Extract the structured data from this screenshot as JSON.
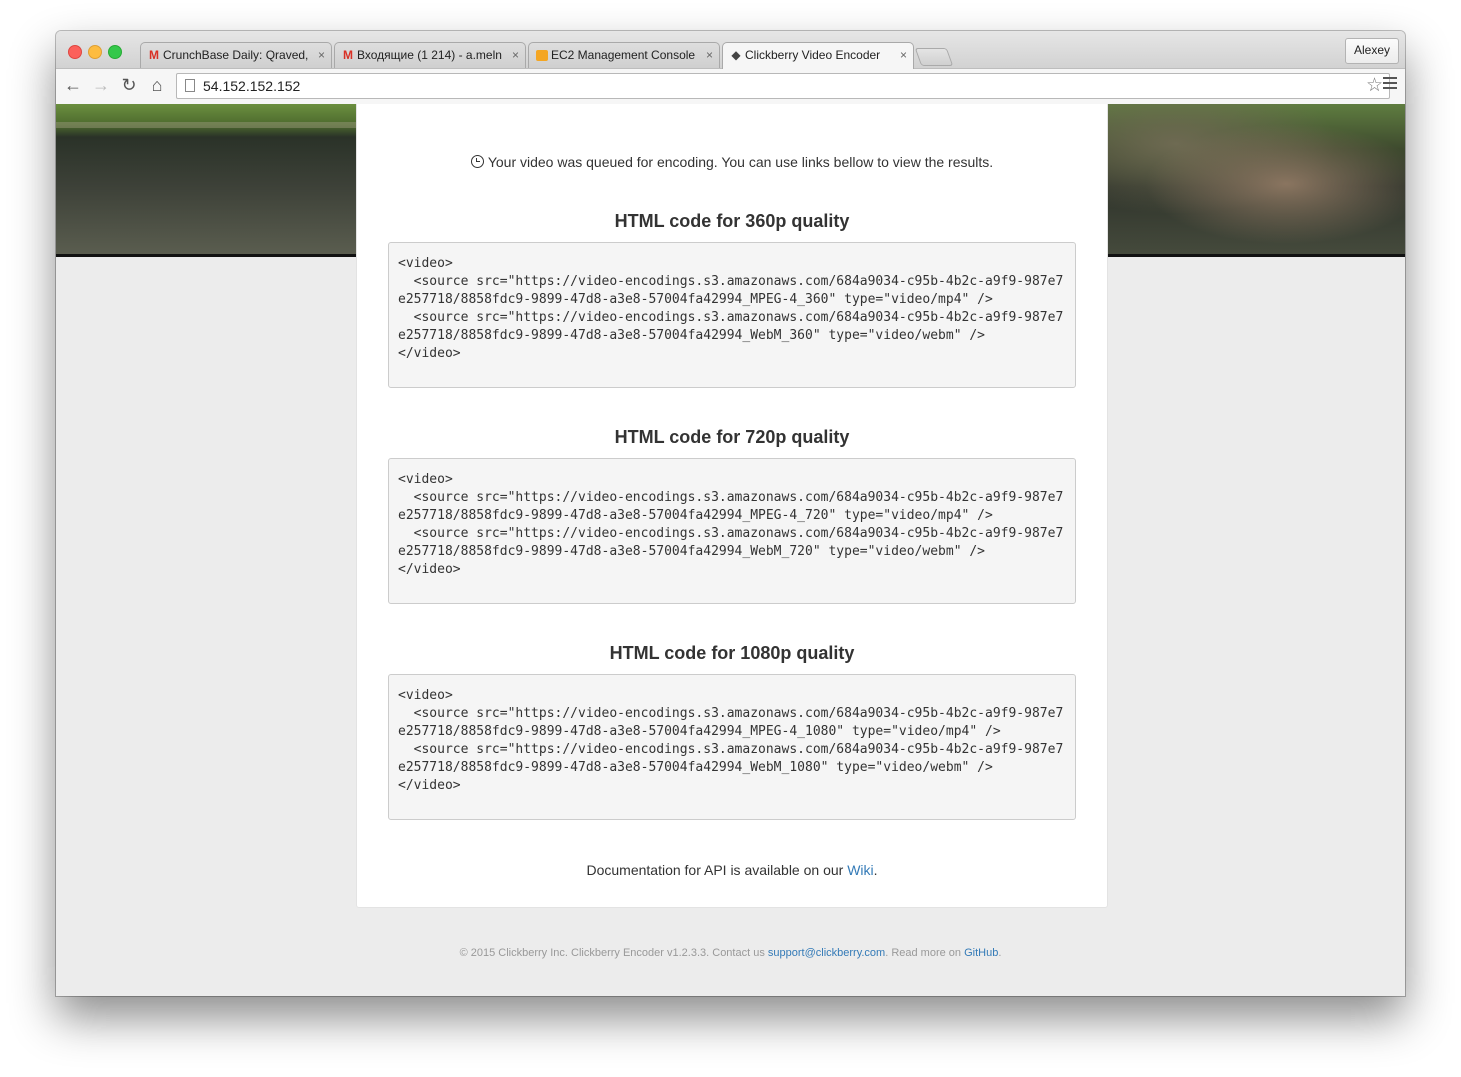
{
  "browser": {
    "tabs": [
      {
        "title": "CrunchBase Daily: Qraved,",
        "icon": "gmail-icon",
        "close": "×"
      },
      {
        "title": "Входящие (1 214) - a.meln",
        "icon": "gmail-icon",
        "close": "×"
      },
      {
        "title": "EC2 Management Console",
        "icon": "aws-icon",
        "close": "×"
      },
      {
        "title": "Clickberry Video Encoder",
        "icon": "clickberry-icon",
        "close": "×"
      }
    ],
    "profile": "Alexey",
    "url": "54.152.152.152",
    "nav": {
      "back": "←",
      "forward": "→",
      "reload": "↻",
      "home": "⌂",
      "star": "☆"
    }
  },
  "page": {
    "queued_message": "Your video was queued for encoding. You can use links bellow to view the results.",
    "sections": [
      {
        "heading": "HTML code for 360p quality",
        "code": "<video>\n  <source src=\"https://video-encodings.s3.amazonaws.com/684a9034-c95b-4b2c-a9f9-987e7\ne257718/8858fdc9-9899-47d8-a3e8-57004fa42994_MPEG-4_360\" type=\"video/mp4\" />\n  <source src=\"https://video-encodings.s3.amazonaws.com/684a9034-c95b-4b2c-a9f9-987e7\ne257718/8858fdc9-9899-47d8-a3e8-57004fa42994_WebM_360\" type=\"video/webm\" />\n</video>"
      },
      {
        "heading": "HTML code for 720p quality",
        "code": "<video>\n  <source src=\"https://video-encodings.s3.amazonaws.com/684a9034-c95b-4b2c-a9f9-987e7\ne257718/8858fdc9-9899-47d8-a3e8-57004fa42994_MPEG-4_720\" type=\"video/mp4\" />\n  <source src=\"https://video-encodings.s3.amazonaws.com/684a9034-c95b-4b2c-a9f9-987e7\ne257718/8858fdc9-9899-47d8-a3e8-57004fa42994_WebM_720\" type=\"video/webm\" />\n</video>"
      },
      {
        "heading": "HTML code for 1080p quality",
        "code": "<video>\n  <source src=\"https://video-encodings.s3.amazonaws.com/684a9034-c95b-4b2c-a9f9-987e7\ne257718/8858fdc9-9899-47d8-a3e8-57004fa42994_MPEG-4_1080\" type=\"video/mp4\" />\n  <source src=\"https://video-encodings.s3.amazonaws.com/684a9034-c95b-4b2c-a9f9-987e7\ne257718/8858fdc9-9899-47d8-a3e8-57004fa42994_WebM_1080\" type=\"video/webm\" />\n</video>"
      }
    ],
    "docs": {
      "before": "Documentation for API is available on our ",
      "link": "Wiki",
      "after": "."
    },
    "footer": {
      "text1": "© 2015 Clickberry Inc. Clickberry Encoder v1.2.3.3. Contact us ",
      "email": "support@clickberry.com",
      "text2": ". Read more on ",
      "github": "GitHub",
      "text3": "."
    }
  },
  "colors": {
    "link": "#337ab7",
    "code_bg": "#f5f5f5",
    "page_bg": "#ececec"
  }
}
